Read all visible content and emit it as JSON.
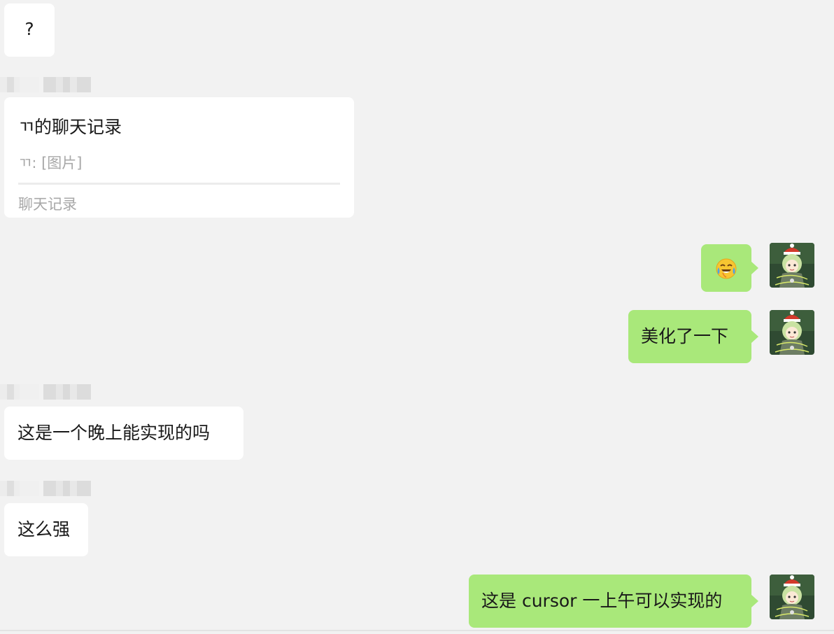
{
  "messages": {
    "m1_text": "?",
    "card": {
      "title": "ㄲ的聊天记录",
      "preview": "ㄲ: [图片]",
      "footer": "聊天记录"
    },
    "m3_emoji": "crying-laughing-emoji",
    "m4_text": "美化了一下",
    "m5_text": "这是一个晚上能实现的吗",
    "m6_text": "这么强",
    "m7_text": "这是 cursor 一上午可以实现的"
  },
  "colors": {
    "background": "#f2f2f2",
    "incoming_bubble": "#ffffff",
    "outgoing_bubble": "#a9e87a",
    "secondary_text": "#a8a8a8"
  },
  "icons": {
    "avatar": "christmas-anime-avatar",
    "emoji": "crying-laughing-emoji"
  }
}
